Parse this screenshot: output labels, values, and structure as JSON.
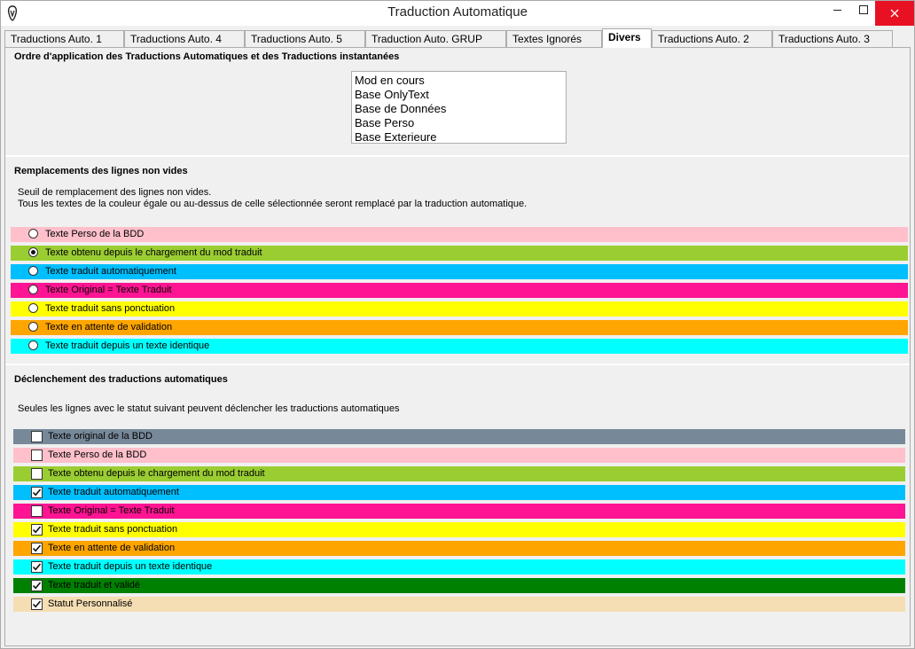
{
  "window": {
    "title": "Traduction Automatique"
  },
  "tabs": [
    {
      "label": "Traductions Auto. 1"
    },
    {
      "label": "Traductions Auto. 4"
    },
    {
      "label": "Traductions Auto. 5"
    },
    {
      "label": "Traduction Auto. GRUP"
    },
    {
      "label": "Textes Ignorés"
    },
    {
      "label": "Divers"
    },
    {
      "label": "Traductions Auto. 2"
    },
    {
      "label": "Traductions Auto. 3"
    }
  ],
  "active_tab": "Divers",
  "section_order": {
    "title": "Ordre d'application des Traductions Automatiques et des Traductions instantanées",
    "items": [
      "Mod en cours",
      "Base OnlyText",
      "Base de Données",
      "Base Perso",
      "Base Exterieure"
    ]
  },
  "section_replace": {
    "title": "Remplacements des lignes non vides",
    "desc_line1": "Seuil de remplacement des lignes non vides.",
    "desc_line2": "Tous les textes de  la couleur égale ou au-dessus de celle sélectionnée seront remplacé par la traduction automatique.",
    "options": [
      {
        "label": "Texte Perso de la BDD",
        "color": "#ffc0cb",
        "selected": false
      },
      {
        "label": "Texte obtenu depuis le chargement du mod traduit",
        "color": "#9acd32",
        "selected": true
      },
      {
        "label": "Texte traduit automatiquement",
        "color": "#00bfff",
        "selected": false
      },
      {
        "label": "Texte Original = Texte Traduit",
        "color": "#ff1493",
        "selected": false
      },
      {
        "label": "Texte traduit sans ponctuation",
        "color": "#ffff00",
        "selected": false
      },
      {
        "label": "Texte en attente de validation",
        "color": "#ffa500",
        "selected": false
      },
      {
        "label": "Texte traduit depuis un texte identique",
        "color": "#00ffff",
        "selected": false
      }
    ]
  },
  "section_trigger": {
    "title": "Déclenchement des traductions automatiques",
    "desc": "Seules les lignes avec le statut suivant peuvent déclencher les traductions automatiques",
    "options": [
      {
        "label": "Texte original de la BDD",
        "color": "#778899",
        "checked": false
      },
      {
        "label": "Texte Perso de la BDD",
        "color": "#ffc0cb",
        "checked": false
      },
      {
        "label": "Texte obtenu depuis le chargement du mod traduit",
        "color": "#9acd32",
        "checked": false
      },
      {
        "label": "Texte traduit automatiquement",
        "color": "#00bfff",
        "checked": true
      },
      {
        "label": "Texte Original = Texte Traduit",
        "color": "#ff1493",
        "checked": false
      },
      {
        "label": "Texte traduit sans ponctuation",
        "color": "#ffff00",
        "checked": true
      },
      {
        "label": "Texte en attente de validation",
        "color": "#ffa500",
        "checked": true
      },
      {
        "label": "Texte traduit depuis un texte identique",
        "color": "#00ffff",
        "checked": true
      },
      {
        "label": "Texte traduit et validé",
        "color": "#008000",
        "checked": true
      },
      {
        "label": "Statut Personnalisé",
        "color": "#f5deb3",
        "checked": true
      }
    ]
  }
}
